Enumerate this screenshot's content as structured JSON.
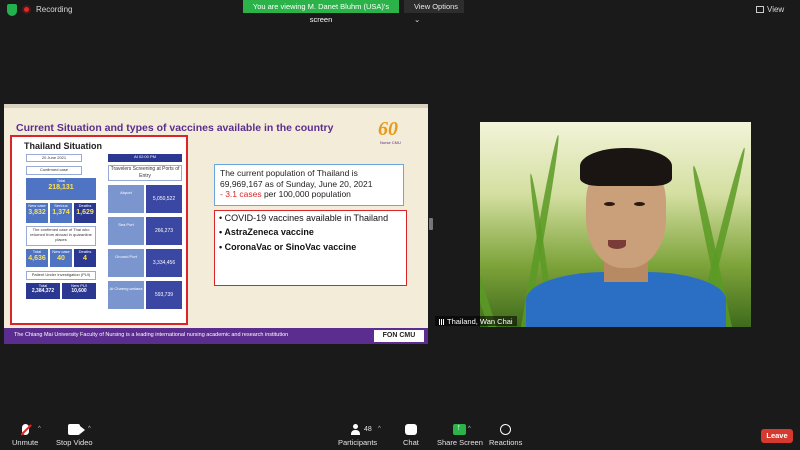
{
  "topbar": {
    "recording_label": "Recording",
    "share_banner": "You are viewing M. Danet Bluhm (USA)'s screen",
    "view_options": "View Options",
    "view_button": "View",
    "chevron": "⌄"
  },
  "slide": {
    "title": "Current Situation and types of vaccines available in the country",
    "logo_number": "60",
    "logo_sub": "Nurse CMU",
    "thailand_panel": {
      "title": "Thailand Situation",
      "date": "20 June 2021",
      "confirmed_label": "Confirmed case",
      "total_label": "Total",
      "total_value": "218,131",
      "new_case_label": "New case",
      "new_case_value": "3,832",
      "serious_label": "Serious",
      "serious_value": "1,374",
      "deaths_label": "Deaths",
      "deaths_value": "1,629",
      "quarantine_label": "The confirmed case of Thai who returned from abroad in quarantine places",
      "q_total_value": "4,636",
      "q_new_value": "40",
      "q_deaths_value": "4",
      "pui_label": "Patient Under Investigation (PUI)",
      "pui_total_label": "Total",
      "pui_total_value": "2,384,372",
      "pui_new_label": "New PUI",
      "pui_new_value": "10,600",
      "time_label": "At 02:00 PM",
      "screening_label": "Travelers Screening at Ports of Entry",
      "ports": [
        {
          "label": "Airport",
          "value": "5,050,522"
        },
        {
          "label": "Sea Port",
          "value": "266,273"
        },
        {
          "label": "Ground Port",
          "value": "3,334,456"
        },
        {
          "label": "At Chaeng watana",
          "value": "593,739"
        }
      ]
    },
    "population_line1": "The current population of Thailand is",
    "population_line2": "69,969,167 as of Sunday, June 20, 2021",
    "population_red": "- 3.1 cases",
    "population_rest": " per 100,000 population",
    "vaccines_heading": "• COVID-19 vaccines available in Thailand",
    "vaccine_1": "• AstraZeneca vaccine",
    "vaccine_2": "• CoronaVac or SinoVac vaccine",
    "footer_text": "The Chiang Mai University Faculty of Nursing is a leading international nursing academic and research institution",
    "footer_logo": "FON CMU"
  },
  "video": {
    "participant_name": "Thailand, Wan Chai"
  },
  "toolbar": {
    "unmute": "Unmute",
    "stop_video": "Stop Video",
    "participants": "Participants",
    "participants_count": "48",
    "chat": "Chat",
    "share_screen": "Share Screen",
    "reactions": "Reactions",
    "leave": "Leave",
    "caret": "^"
  },
  "colors": {
    "share_green": "#2bb34a",
    "leave_red": "#d63a2f",
    "slide_purple": "#5b2d8e",
    "panel_red": "#d9252a"
  }
}
